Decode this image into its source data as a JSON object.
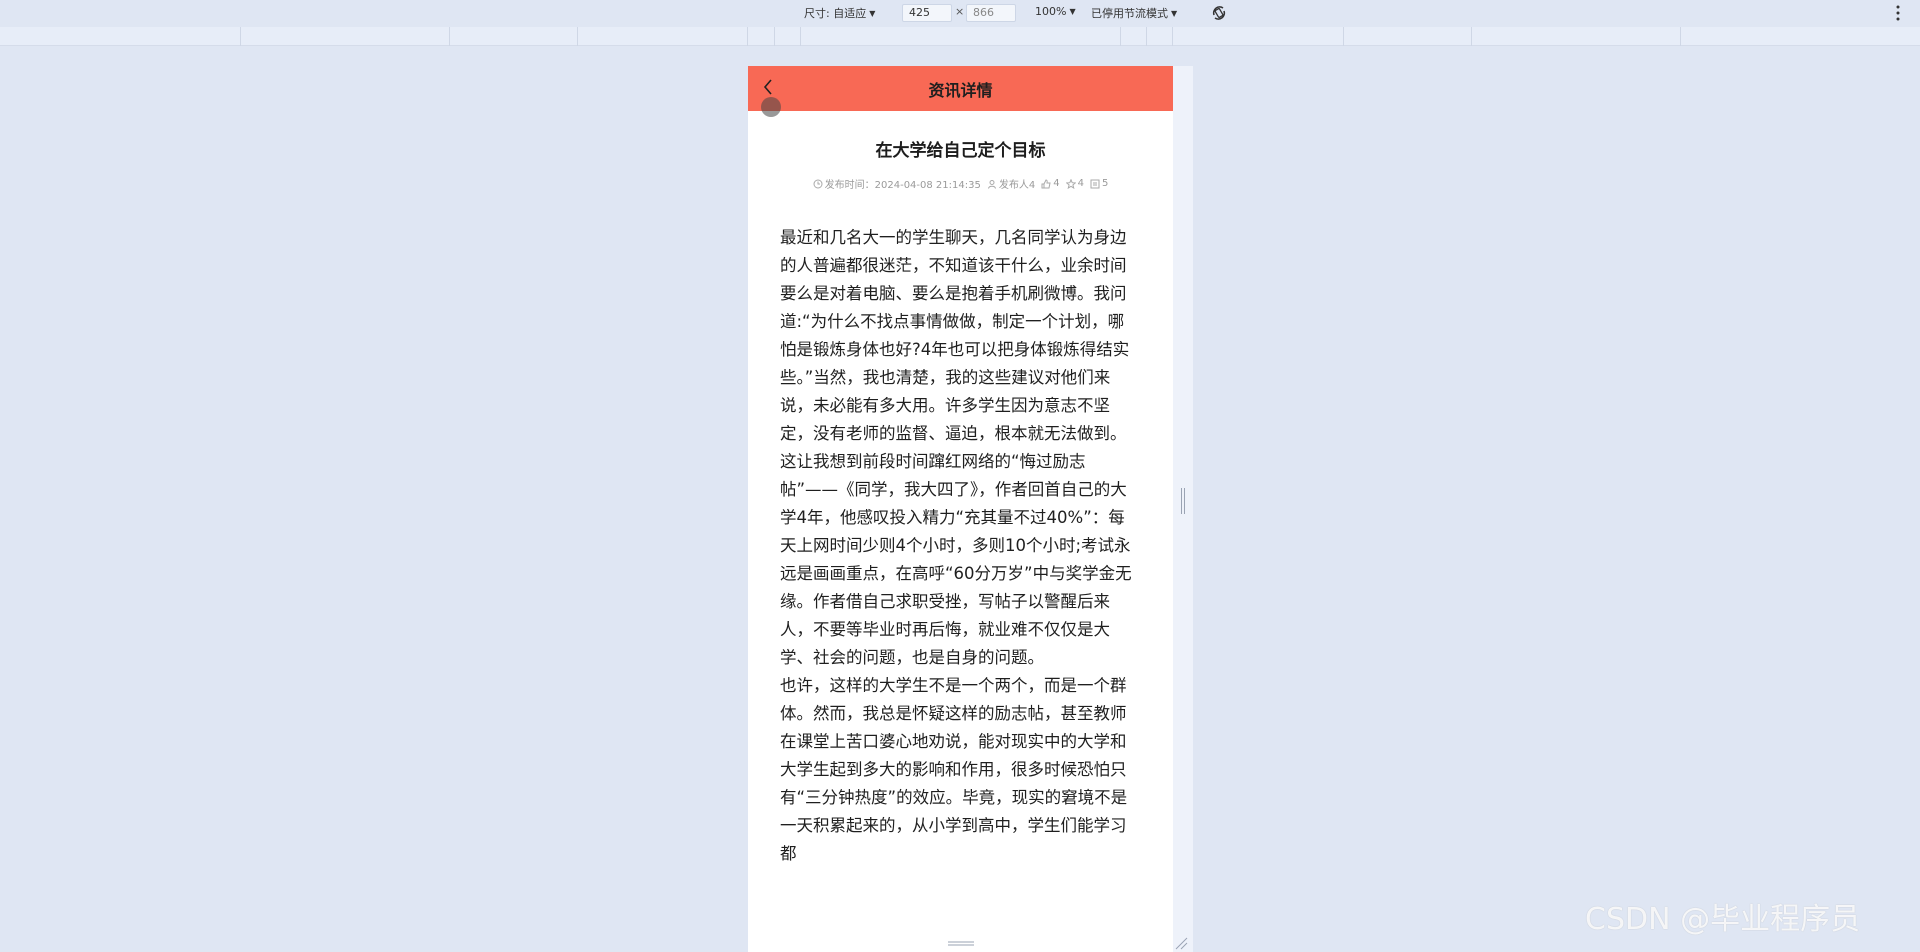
{
  "toolbar": {
    "size_label": "尺寸: 自适应",
    "width_value": "425",
    "height_placeholder": "866",
    "times": "×",
    "zoom": "100%",
    "throttle": "已停用节流模式",
    "icons": [
      "rotate-icon",
      "more-vertical-icon"
    ]
  },
  "page": {
    "header_title": "资讯详情",
    "article_title": "在大学给自己定个目标",
    "meta": {
      "publish_time": "发布时间：2024-04-08 21:14:35",
      "publisher": "发布人4",
      "likes": "4",
      "favorites": "4",
      "views": "5"
    },
    "paragraphs": [
      "最近和几名大一的学生聊天，几名同学认为身边的人普遍都很迷茫，不知道该干什么，业余时间要么是对着电脑、要么是抱着手机刷微博。我问道:“为什么不找点事情做做，制定一个计划，哪怕是锻炼身体也好?4年也可以把身体锻炼得结实些。”当然，我也清楚，我的这些建议对他们来说，未必能有多大用。许多学生因为意志不坚定，没有老师的监督、逼迫，根本就无法做到。",
      "这让我想到前段时间蹿红网络的“悔过励志帖”——《同学，我大四了》，作者回首自己的大学4年，他感叹投入精力“充其量不过40%”：每天上网时间少则4个小时，多则10个小时;考试永远是画画重点，在高呼“60分万岁”中与奖学金无缘。作者借自己求职受挫，写帖子以警醒后来人，不要等毕业时再后悔，就业难不仅仅是大学、社会的问题，也是自身的问题。",
      "也许，这样的大学生不是一个两个，而是一个群体。然而，我总是怀疑这样的励志帖，甚至教师在课堂上苦口婆心地劝说，能对现实中的大学和大学生起到多大的影响和作用，很多时候恐怕只有“三分钟热度”的效应。毕竟，现实的窘境不是一天积累起来的，从小学到高中，学生们能学习都"
    ]
  },
  "watermark": "CSDN @毕业程序员"
}
